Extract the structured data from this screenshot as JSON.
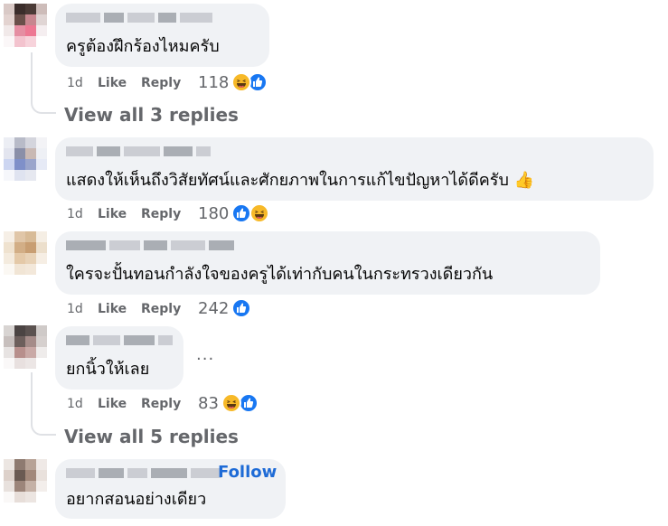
{
  "comments": [
    {
      "text": "ครูต้องฝึกร้องไหมครับ",
      "time": "1d",
      "like_label": "Like",
      "reply_label": "Reply",
      "reaction_count": "118",
      "reactions": [
        "haha",
        "like"
      ],
      "view_replies": "View all 3 replies"
    },
    {
      "text": "แสดงให้เห็นถึงวิสัยทัศน์และศักยภาพในการแก้ไขปัญหาได้ดีครับ 👍",
      "time": "1d",
      "like_label": "Like",
      "reply_label": "Reply",
      "reaction_count": "180",
      "reactions": [
        "like",
        "haha"
      ]
    },
    {
      "text": "ใครจะปั้นทอนกำลังใจของครูได้เท่ากับคนในกระทรวงเดียวกัน",
      "time": "1d",
      "like_label": "Like",
      "reply_label": "Reply",
      "reaction_count": "242",
      "reactions": [
        "like"
      ]
    },
    {
      "text": "ยกนิ้วให้เลย",
      "time": "1d",
      "like_label": "Like",
      "reply_label": "Reply",
      "reaction_count": "83",
      "reactions": [
        "haha",
        "like"
      ],
      "more_options": "...",
      "view_replies": "View all 5 replies"
    },
    {
      "text": "อยากสอนอย่างเดียว",
      "follow_label": "Follow"
    }
  ],
  "colors": {
    "bubble": "#f0f2f5",
    "meta": "#65676b",
    "like": "#1877f2",
    "haha": "#f7b928",
    "follow": "#1e6bd6"
  }
}
